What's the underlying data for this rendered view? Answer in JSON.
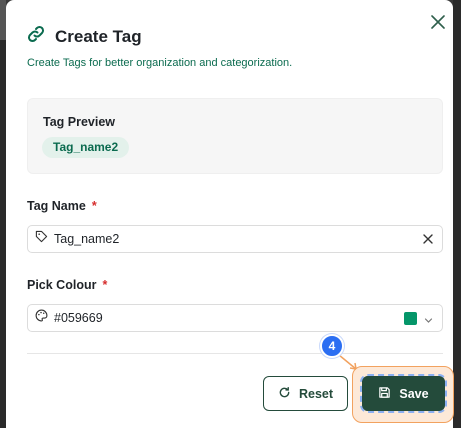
{
  "dialog": {
    "title": "Create Tag",
    "subtitle": "Create Tags for better organization and categorization.",
    "icons": {
      "title": "link-icon",
      "close": "close-icon"
    }
  },
  "preview": {
    "label": "Tag Preview",
    "chip_text": "Tag_name2"
  },
  "tag_name": {
    "label": "Tag Name",
    "required_mark": "*",
    "value": "Tag_name2",
    "icon": "tag-icon"
  },
  "colour": {
    "label": "Pick Colour",
    "required_mark": "*",
    "value": "#059669",
    "swatch_color": "#059669",
    "icon": "palette-icon"
  },
  "actions": {
    "reset_label": "Reset",
    "save_label": "Save"
  },
  "annotation": {
    "step": "4"
  },
  "colors": {
    "brand_dark": "#244b3b",
    "brand_text": "#0b6b4f",
    "required": "#d62d2d",
    "step_badge": "#2b6ef2",
    "highlight": "#f2a25f"
  }
}
